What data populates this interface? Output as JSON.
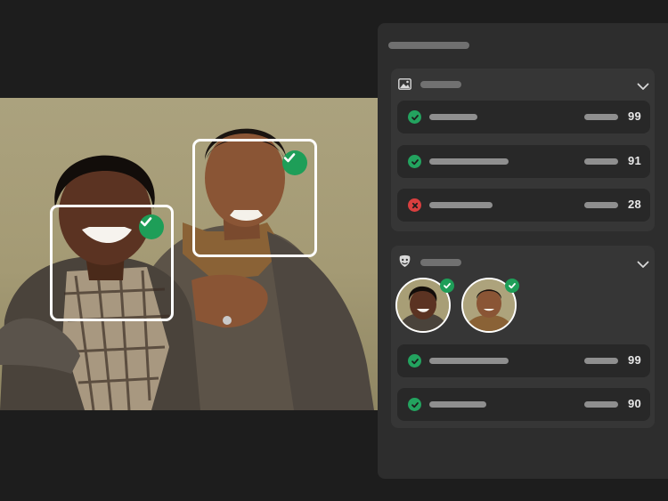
{
  "photo": {
    "faces": [
      {
        "name": "face-left",
        "detected": true
      },
      {
        "name": "face-right",
        "detected": true
      }
    ]
  },
  "panel": {
    "image_group": {
      "icon": "image-icon",
      "expand_icon": "chevron-down-icon",
      "rows": [
        {
          "status": "pass",
          "score": "99"
        },
        {
          "status": "pass",
          "score": "91"
        },
        {
          "status": "fail",
          "score": "28"
        }
      ]
    },
    "face_group": {
      "icon": "face-icon",
      "expand_icon": "chevron-down-icon",
      "rows": [
        {
          "status": "pass",
          "score": "99"
        },
        {
          "status": "pass",
          "score": "90"
        }
      ]
    }
  },
  "colors": {
    "accent_pass": "#1e9e58",
    "accent_fail": "#d93f3f",
    "panel_bg": "#2d2d2d",
    "app_bg": "#1d1d1d"
  }
}
